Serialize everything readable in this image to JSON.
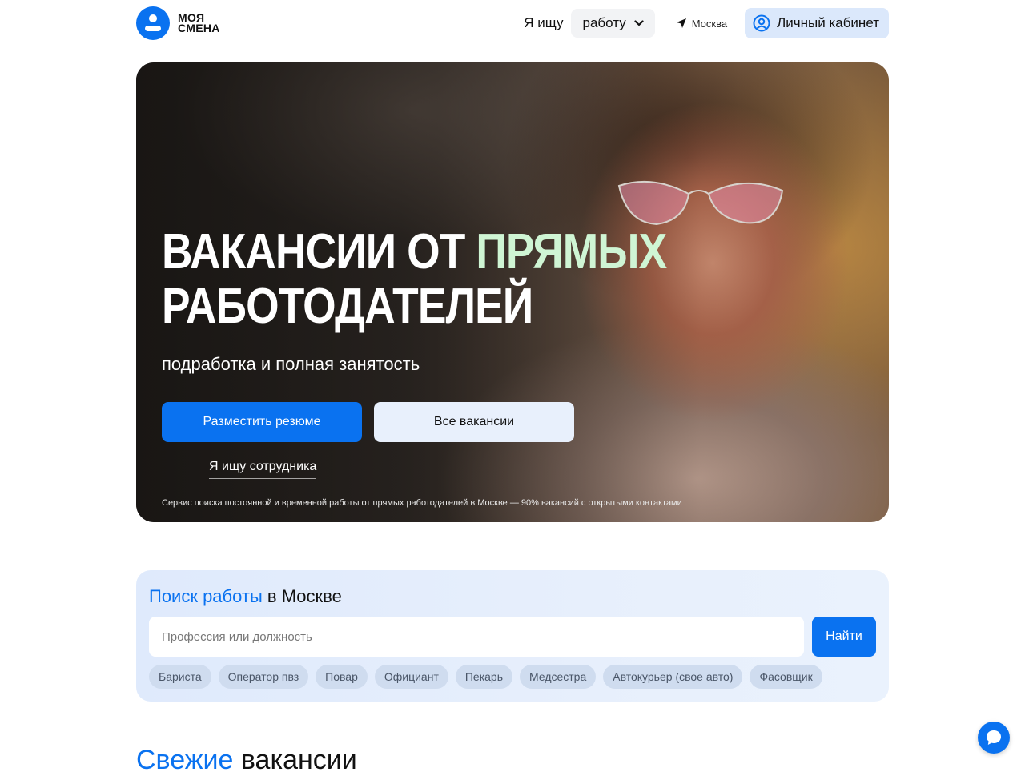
{
  "header": {
    "logo_line1": "моя",
    "logo_line2": "смена",
    "search_label": "Я ищу",
    "search_mode": "работу",
    "city": "Москва",
    "cabinet_label": "Личный кабинет"
  },
  "hero": {
    "title_part1": "ВАКАНСИИ ОТ",
    "title_accent": "ПРЯМЫХ",
    "title_line2": "РАБОТОДАТЕЛЕЙ",
    "subtitle": "подработка и полная занятость",
    "primary_button": "Разместить резюме",
    "secondary_button": "Все вакансии",
    "employer_link": "Я ищу сотрудника",
    "note": "Сервис поиска постоянной и временной работы от прямых работодателей в Москве — 90% вакансий с открытыми контактами"
  },
  "search": {
    "title_accent": "Поиск работы",
    "title_rest": "в Москве",
    "placeholder": "Профессия или должность",
    "button": "Найти",
    "tags": [
      "Бариста",
      "Оператор пвз",
      "Повар",
      "Официант",
      "Пекарь",
      "Медсестра",
      "Автокурьер (свое авто)",
      "Фасовщик"
    ]
  },
  "fresh": {
    "title_accent": "Свежие",
    "title_rest": "вакансии"
  },
  "colors": {
    "brand": "#0a72f0",
    "accent_green": "#cff5d4",
    "search_bg": "#dfeafc"
  }
}
